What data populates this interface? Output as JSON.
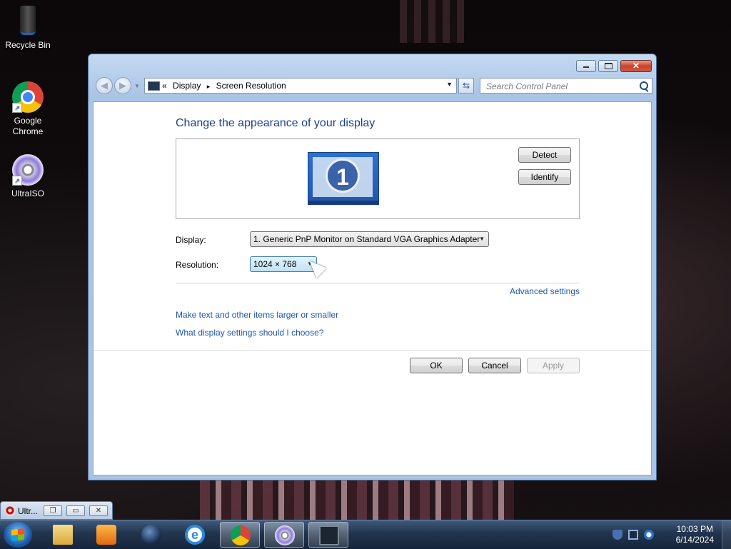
{
  "desktop": {
    "icons": [
      {
        "label": "Recycle Bin",
        "icon": "recycle-bin-icon"
      },
      {
        "label": "Google\nChrome",
        "icon": "chrome-icon"
      },
      {
        "label": "UltraISO",
        "icon": "ultraiso-icon"
      }
    ]
  },
  "window": {
    "breadcrumbs": [
      "«",
      "Display",
      "▸",
      "Screen Resolution"
    ],
    "search_placeholder": "Search Control Panel",
    "heading": "Change the appearance of your display",
    "monitor_number": "1",
    "buttons": {
      "detect": "Detect",
      "identify": "Identify",
      "ok": "OK",
      "cancel": "Cancel",
      "apply": "Apply"
    },
    "display_label": "Display:",
    "display_value": "1. Generic PnP Monitor on Standard VGA Graphics Adapter",
    "resolution_label": "Resolution:",
    "resolution_value": "1024 × 768",
    "links": {
      "advanced": "Advanced settings",
      "larger_text": "Make text and other items larger or smaller",
      "which_settings": "What display settings should I choose?"
    }
  },
  "thumbnail": {
    "label": "Ultr..."
  },
  "taskbar": {
    "items": [
      {
        "icon": "windows-explorer-icon",
        "active": false
      },
      {
        "icon": "media-player-icon",
        "active": false
      },
      {
        "icon": "app-orb-icon",
        "active": false
      },
      {
        "icon": "internet-explorer-icon",
        "active": false
      },
      {
        "icon": "chrome-icon",
        "active": true
      },
      {
        "icon": "ultraiso-icon",
        "active": true
      },
      {
        "icon": "display-settings-icon",
        "active": true
      }
    ],
    "clock_time": "10:03 PM",
    "clock_date": "6/14/2024"
  }
}
